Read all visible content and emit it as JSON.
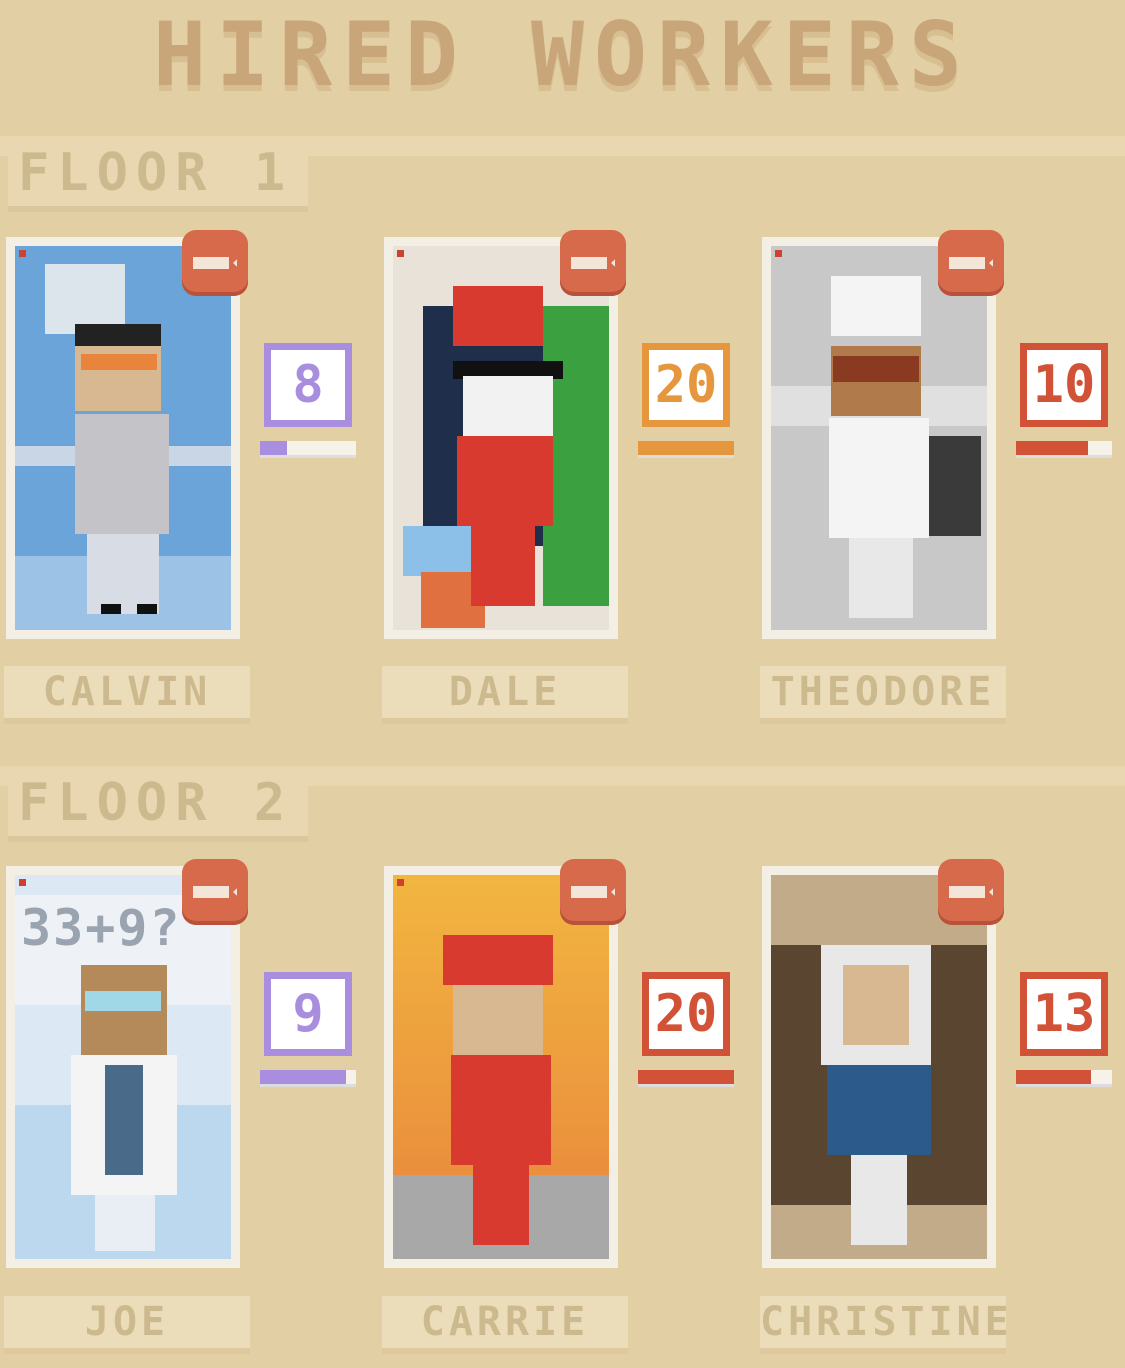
{
  "title": "HIRED WORKERS",
  "floors": [
    {
      "label": "FLOOR 1",
      "workers": [
        {
          "name": "CALVIN",
          "level": "8",
          "fill": 0.28,
          "color": "#a98ee0"
        },
        {
          "name": "DALE",
          "level": "20",
          "fill": 1.0,
          "color": "#e6963c"
        },
        {
          "name": "THEODORE",
          "level": "10",
          "fill": 0.75,
          "color": "#d15236"
        }
      ]
    },
    {
      "label": "FLOOR 2",
      "workers": [
        {
          "name": "JOE",
          "level": "9",
          "fill": 0.9,
          "color": "#a98ee0"
        },
        {
          "name": "CARRIE",
          "level": "20",
          "fill": 1.0,
          "color": "#d15236"
        },
        {
          "name": "CHRISTINE",
          "level": "13",
          "fill": 0.78,
          "color": "#d15236"
        }
      ]
    }
  ],
  "scene_text": {
    "math": "33+9?"
  }
}
